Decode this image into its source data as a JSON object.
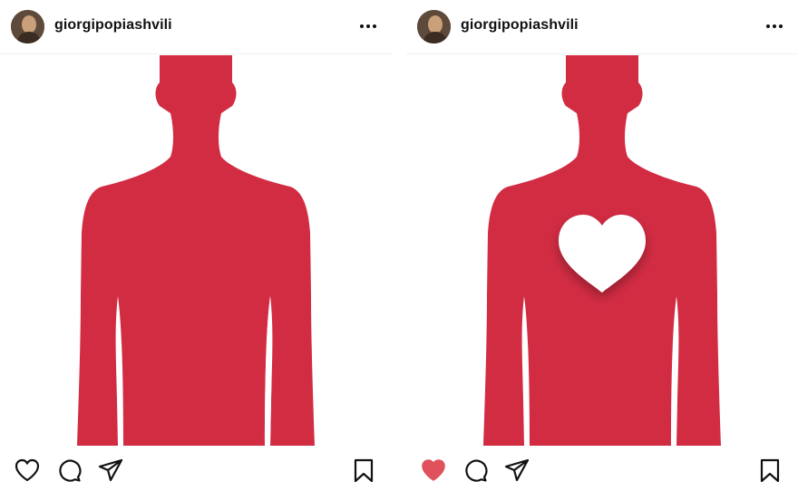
{
  "posts": [
    {
      "username": "giorgipopiashvili",
      "liked": false,
      "image": {
        "figure_color": "#D22C43",
        "has_heart": false
      }
    },
    {
      "username": "giorgipopiashvili",
      "liked": true,
      "image": {
        "figure_color": "#D22C43",
        "has_heart": true
      }
    }
  ],
  "colors": {
    "like_active": "#E0525B",
    "icon": "#111111",
    "figure": "#D22C43"
  },
  "icons": {
    "avatar": "avatar",
    "more": "more-dots-icon",
    "like": "heart-icon",
    "comment": "comment-bubble-icon",
    "share": "paper-plane-icon",
    "save": "bookmark-icon"
  }
}
